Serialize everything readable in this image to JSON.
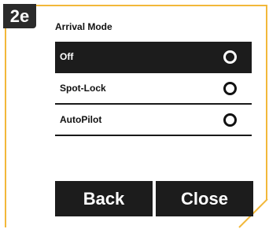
{
  "step": {
    "label": "2e"
  },
  "panel": {
    "title": "Arrival Mode",
    "options": [
      {
        "label": "Off",
        "selected": true
      },
      {
        "label": "Spot-Lock",
        "selected": false
      },
      {
        "label": "AutoPilot",
        "selected": false
      }
    ]
  },
  "buttons": {
    "back_label": "Back",
    "close_label": "Close"
  },
  "colors": {
    "accent": "#f2b83a",
    "dark": "#1c1c1c",
    "badge": "#2b2b2b"
  }
}
